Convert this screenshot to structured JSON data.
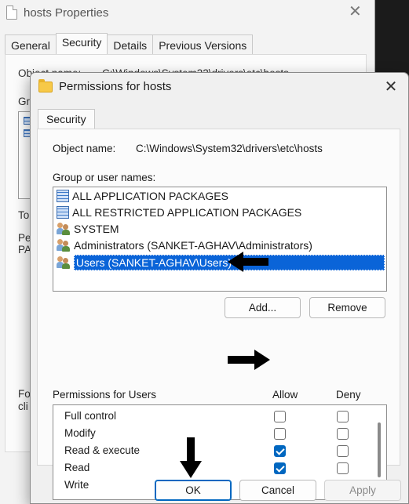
{
  "background_window": {
    "title": "hosts Properties",
    "close_glyph": "✕",
    "tabs": [
      "General",
      "Security",
      "Details",
      "Previous Versions"
    ],
    "fragments": {
      "object": "Object name:",
      "path": "C:\\Windows\\System32\\drivers\\etc\\hosts",
      "group": "Gr",
      "to": "To",
      "pe": "Pe",
      "pa": "PA",
      "fo": "Fo",
      "cli": "cli"
    }
  },
  "dialog": {
    "title": "Permissions for hosts",
    "close_glyph": "✕",
    "tab": "Security",
    "object_name_label": "Object name:",
    "object_name_value": "C:\\Windows\\System32\\drivers\\etc\\hosts",
    "group_label": "Group or user names:",
    "users": [
      {
        "name": "ALL APPLICATION PACKAGES",
        "icon": "package-icon"
      },
      {
        "name": "ALL RESTRICTED APPLICATION PACKAGES",
        "icon": "package-icon"
      },
      {
        "name": "SYSTEM",
        "icon": "users-group-icon"
      },
      {
        "name": "Administrators (SANKET-AGHAV\\Administrators)",
        "icon": "users-group-icon"
      },
      {
        "name": "Users (SANKET-AGHAV\\Users)",
        "icon": "users-group-icon",
        "selected": true
      }
    ],
    "add_button": "Add...",
    "remove_button": "Remove",
    "permissions_label": "Permissions for Users",
    "allow_header": "Allow",
    "deny_header": "Deny",
    "permissions": [
      {
        "name": "Full control",
        "allow": false,
        "deny": false
      },
      {
        "name": "Modify",
        "allow": false,
        "deny": false
      },
      {
        "name": "Read & execute",
        "allow": true,
        "deny": false
      },
      {
        "name": "Read",
        "allow": true,
        "deny": false
      },
      {
        "name": "Write",
        "allow": false,
        "deny": false
      }
    ],
    "ok_button": "OK",
    "cancel_button": "Cancel",
    "apply_button": "Apply"
  },
  "colors": {
    "accent": "#0067c0",
    "selection": "#0a64d8",
    "arrow": "#000000"
  }
}
